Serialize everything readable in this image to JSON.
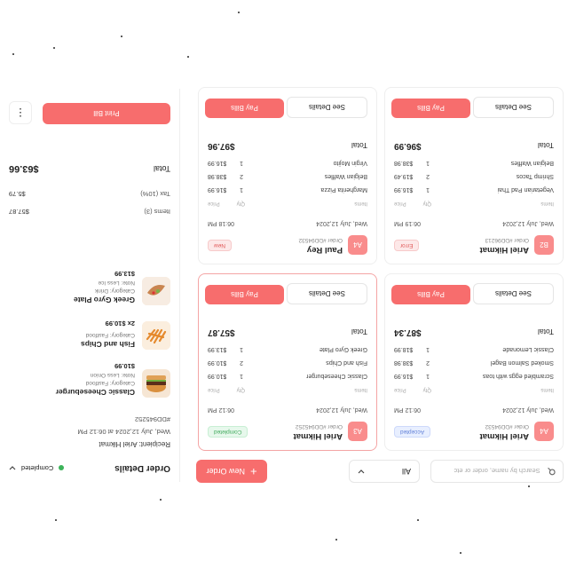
{
  "toolbar": {
    "search_placeholder": "Search by name, order or etc",
    "filter_value": "All",
    "new_order_label": "New Order"
  },
  "cards": [
    {
      "badge": "A4",
      "customer": "Ariel Hikmat",
      "order_no": "Order #DD94532",
      "status": "Accepted",
      "status_kind": "accepted",
      "date": "Wed, July 12,2024",
      "time": "06:12 PM",
      "col_items": "Items",
      "col_qty": "Qty",
      "col_price": "Price",
      "items": [
        {
          "name": "Scrambled eggs with toas",
          "qty": "1",
          "price": "$16.99"
        },
        {
          "name": "Smoked Salmon Bagel",
          "qty": "2",
          "price": "$38.98"
        },
        {
          "name": "Classic Lemonade",
          "qty": "1",
          "price": "$18.99"
        }
      ],
      "total_label": "Total",
      "total": "$87.34",
      "details_label": "See Details",
      "pay_label": "Pay Bills"
    },
    {
      "badge": "A3",
      "customer": "Ariel Hikmat",
      "order_no": "Order #DD945252",
      "status": "Completed",
      "status_kind": "completed",
      "date": "Wed, July 12,2024",
      "time": "06:12 PM",
      "col_items": "Items",
      "col_qty": "Qty",
      "col_price": "Price",
      "items": [
        {
          "name": "Classic Cheeseburger",
          "qty": "1",
          "price": "$10.99"
        },
        {
          "name": "Fish and Chips",
          "qty": "2",
          "price": "$10.99"
        },
        {
          "name": "Greek Gyro Plate",
          "qty": "1",
          "price": "$13.99"
        }
      ],
      "total_label": "Total",
      "total": "$57.87",
      "details_label": "See Details",
      "pay_label": "Pay Bills"
    },
    {
      "badge": "B2",
      "customer": "Ariel Hikmat",
      "order_no": "Order #DD96213",
      "status": "Error",
      "status_kind": "error",
      "date": "Wed, July 12,2024",
      "time": "06:19 PM",
      "col_items": "Items",
      "col_qty": "Qty",
      "col_price": "Price",
      "items": [
        {
          "name": "Vegetarian Pad Thai",
          "qty": "1",
          "price": "$16.99"
        },
        {
          "name": "Shrimp Tacos",
          "qty": "2",
          "price": "$19.49"
        },
        {
          "name": "Belgian Waffles",
          "qty": "1",
          "price": "$38.98"
        }
      ],
      "total_label": "Total",
      "total": "$96.99",
      "details_label": "See Details",
      "pay_label": "Pay Bills"
    },
    {
      "badge": "A4",
      "customer": "Paul Rey",
      "order_no": "Order #DD94532",
      "status": "New",
      "status_kind": "new",
      "date": "Wed, July 12,2024",
      "time": "06:18 PM",
      "col_items": "Items",
      "col_qty": "Qty",
      "col_price": "Price",
      "items": [
        {
          "name": "Margherita Pizza",
          "qty": "1",
          "price": "$16.99"
        },
        {
          "name": "Belgian Waffles",
          "qty": "2",
          "price": "$38.98"
        },
        {
          "name": "Virgin Mojito",
          "qty": "1",
          "price": "$16.99"
        }
      ],
      "total_label": "Total",
      "total": "$97.96",
      "details_label": "See Details",
      "pay_label": "Pay Bills"
    }
  ],
  "panel": {
    "title": "Order Details",
    "status": "Completed",
    "recipient": "Recipient: Ariel Hikmat",
    "datetime": "Wed, July 12,2024 at 06:12 PM",
    "order_no": "#DD945252",
    "items": [
      {
        "name": "Classic Cheeseburger",
        "category": "Category: Fastfood",
        "note": "Note: Less Onion",
        "price": "$10.99",
        "icon": "burger-image"
      },
      {
        "name": "Fish and Chips",
        "category": "Category: Fastfood",
        "note": "",
        "price": "2x $10.99",
        "icon": "fries-image"
      },
      {
        "name": "Greek Gyro Plate",
        "category": "Category: Drink",
        "note": "Note: Less Ice",
        "price": "$13.99",
        "icon": "gyro-image"
      }
    ],
    "items_label": "Items (3)",
    "items_value": "$57.87",
    "tax_label": "Tax (10%)",
    "tax_value": "$5.79",
    "total_label": "Total",
    "total_value": "$63.66",
    "print_label": "Print Bill"
  },
  "colors": {
    "accent": "#f76d6d",
    "badge": "#f98c8c",
    "completed": "#3db35a"
  }
}
